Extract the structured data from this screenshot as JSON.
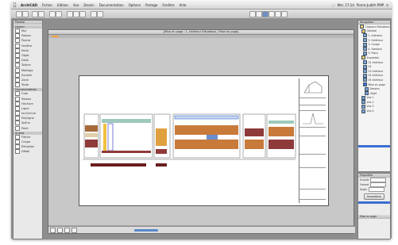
{
  "menubar": {
    "app_name": "ArchiCAD",
    "items": [
      "Fichier",
      "Edition",
      "Vue",
      "Dessin",
      "Documentation",
      "Options",
      "Partage",
      "Fenêtre",
      "Aide"
    ],
    "right_status": [
      "Mer. 17:14",
      "Pierre-Judith PMP"
    ]
  },
  "toolbox": {
    "title": "Palette",
    "sections": [
      {
        "name": "Dessin",
        "items": [
          "Mur",
          "Poteau",
          "Poutre",
          "Fenêtre",
          "Porte",
          "Objet",
          "Dalle",
          "Toiture",
          "Maillage",
          "Escalier",
          "Zone",
          "Texte"
        ]
      },
      {
        "name": "Documentation",
        "items": [
          "Cote",
          "Niveau",
          "Hachure",
          "Ligne",
          "Arc/Cercle",
          "Polyligne",
          "Spline",
          "Point"
        ]
      },
      {
        "name": "Autres",
        "items": [
          "Flèche",
          "Coupe",
          "Élévation",
          "Détail"
        ]
      }
    ]
  },
  "document": {
    "title": "[Mise en page : 1. Intérieur Elévations / Mise en page]"
  },
  "navigator": {
    "title": "Navigateur",
    "tree": [
      "Classeur Elévations",
      "Général",
      "1. Intérieur",
      "2. Extérieur",
      "3. Coupe",
      "4. Sections",
      "5. Plans",
      "Ensemble",
      "01 Intérieur",
      "02",
      "03 Intérieur",
      "04 Intérieur",
      "05 Intérieur",
      "Mise en page",
      "Dessins",
      "Objet",
      "Vue 1",
      "Vue 2",
      "Vue 3",
      "Vue 4"
    ]
  },
  "info_palette": {
    "title": "Propriétés",
    "rows": [
      "Echelle",
      "Format",
      "Angle"
    ],
    "button_label": "Paramètres",
    "footer_label": "Mise en page"
  }
}
